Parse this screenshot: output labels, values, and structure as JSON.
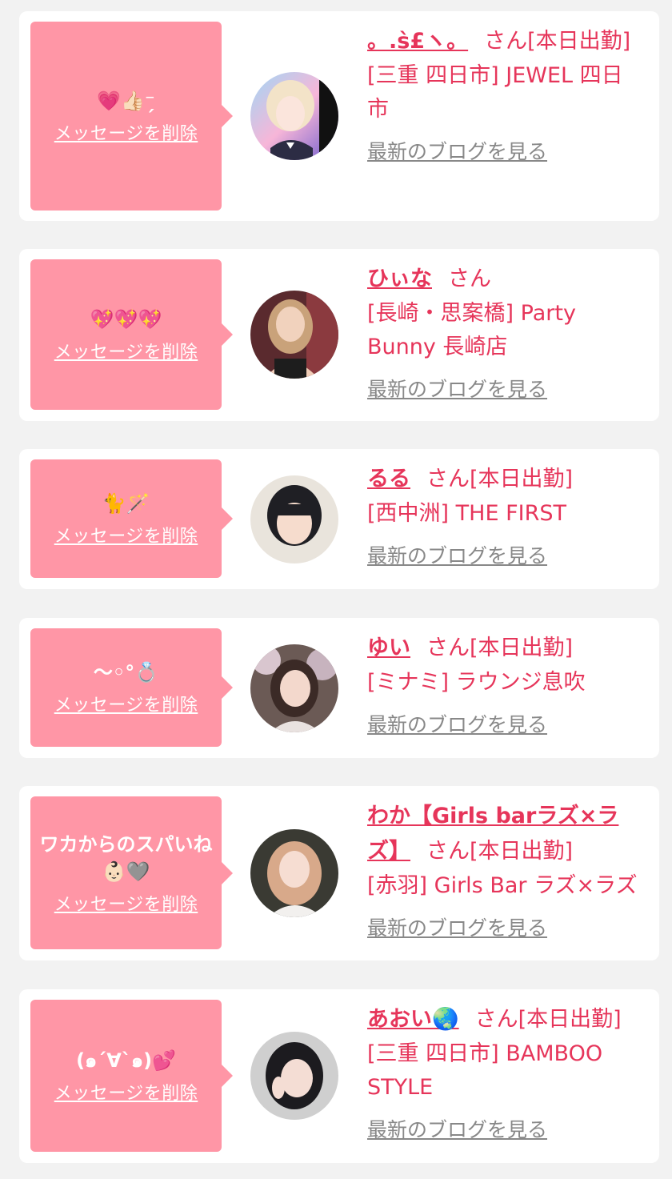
{
  "cards": [
    {
      "message": "💗👍🏻⁻̗",
      "delete_label": "メッセージを削除",
      "name": "。.ꜱ̀£ヽ。",
      "san": "さん[本日出勤]",
      "shop": "[三重 四日市] JEWEL 四日市",
      "blog_label": "最新のブログを見る"
    },
    {
      "message": "💖💖💖",
      "delete_label": "メッセージを削除",
      "name": "ひぃな",
      "san": "さん",
      "shop": "[長崎・思案橋] Party Bunny 長崎店",
      "blog_label": "最新のブログを見る"
    },
    {
      "message": "🐈🪄",
      "delete_label": "メッセージを削除",
      "name": "るる",
      "san": "さん[本日出勤]",
      "shop": "[西中洲] THE FIRST",
      "blog_label": "最新のブログを見る"
    },
    {
      "message": "〜◦°💍",
      "delete_label": "メッセージを削除",
      "name": "ゆい",
      "san": "さん[本日出勤]",
      "shop": "[ミナミ] ラウンジ息吹",
      "blog_label": "最新のブログを見る"
    },
    {
      "message": "ワカからのスパいね👶🏻🩶",
      "delete_label": "メッセージを削除",
      "name": "わか【Girls barラズ×ラズ】",
      "san": "さん[本日出勤]",
      "shop": "[赤羽] Girls Bar ラズ×ラズ",
      "blog_label": "最新のブログを見る"
    },
    {
      "message": "(๑´∀`๑)💕",
      "delete_label": "メッセージを削除",
      "name": "あおい🌏",
      "san": "さん[本日出勤]",
      "shop": "[三重 四日市] BAMBOO STYLE",
      "blog_label": "最新のブログを見る"
    }
  ],
  "colors": {
    "page_bg": "#f2f2f2",
    "bubble": "#ff96a6",
    "accent": "#e6355a",
    "link_gray": "#888888"
  }
}
